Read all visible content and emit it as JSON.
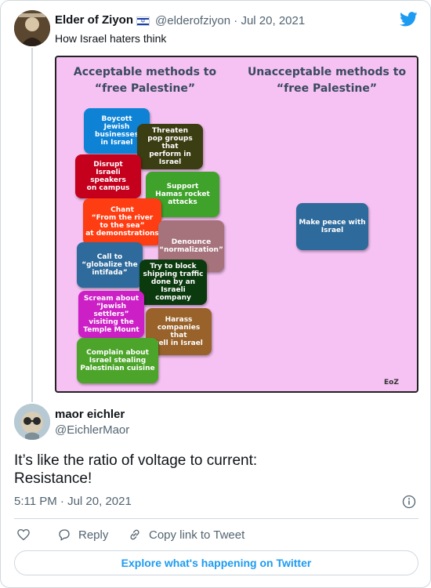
{
  "quoted_tweet": {
    "author_name": "Elder of Ziyon",
    "flag_icon": "israel-flag-icon",
    "handle": "@elderofziyon",
    "separator": "·",
    "date": "Jul 20, 2021",
    "text": "How Israel haters think"
  },
  "meme": {
    "left_title": "Acceptable methods to\n“free Palestine”",
    "right_title": "Unacceptable methods to\n“free Palestine”",
    "acceptable_items": [
      {
        "label": "Boycott\nJewish\nbusinesses\nin Israel",
        "color": "#0e83d6"
      },
      {
        "label": "Threaten\npop groups that\nperform in\nIsrael",
        "color": "#3b3d12"
      },
      {
        "label": "Disrupt\nIsraeli speakers\non campus",
        "color": "#c4001d"
      },
      {
        "label": "Support\nHamas rocket\nattacks",
        "color": "#3fa32b"
      },
      {
        "label": "Chant\n“From the river\nto the sea”\nat demonstrations",
        "color": "#ff3d12"
      },
      {
        "label": "Denounce\n“normalization”",
        "color": "#a6737c"
      },
      {
        "label": "Call to\n“globalize the\nintifada”",
        "color": "#2e6a9b"
      },
      {
        "label": "Try to block\nshipping traffic\ndone by an\nIsraeli company",
        "color": "#0c3a0f"
      },
      {
        "label": "Scream about\n“Jewish settlers”\nvisiting the\nTemple Mount",
        "color": "#cc1fc6"
      },
      {
        "label": "Harass\ncompanies that\nsell in Israel",
        "color": "#98622a"
      },
      {
        "label": "Complain about\nIsrael stealing\nPalestinian cuisine",
        "color": "#4ca52a"
      }
    ],
    "unacceptable_items": [
      {
        "label": "Make peace with\nIsrael",
        "color": "#2e6a9b"
      }
    ],
    "credit": "EoZ"
  },
  "main_tweet": {
    "author_name": "maor eichler",
    "handle": "@EichlerMaor",
    "text_line1": "It’s like the ratio of voltage to current:",
    "text_line2": "Resistance!",
    "time": "5:11 PM",
    "separator": "·",
    "date": "Jul 20, 2021"
  },
  "actions": {
    "like_icon": "heart-icon",
    "reply_label": "Reply",
    "copy_link_label": "Copy link to Tweet"
  },
  "explore_label": "Explore what's happening on Twitter",
  "colors": {
    "accent": "#1d9bf0",
    "meme_background": "#f6c2f3",
    "secondary_text": "#536471"
  }
}
